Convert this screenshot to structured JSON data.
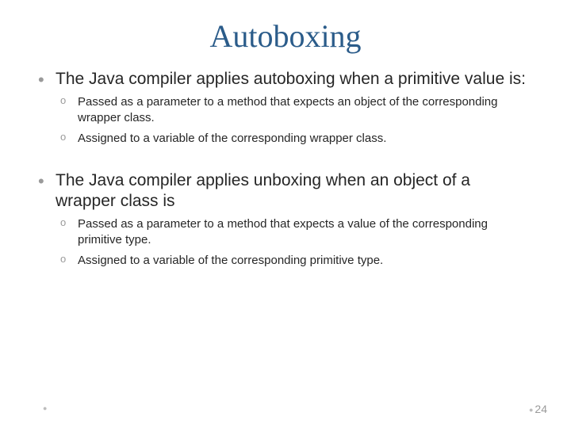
{
  "title": "Autoboxing",
  "bullets": {
    "item1": {
      "text": "The Java compiler applies autoboxing when a primitive value is:",
      "sub1": "Passed as a parameter to a method that expects an object of the corresponding wrapper class.",
      "sub2": "Assigned to a variable of the corresponding wrapper class."
    },
    "item2": {
      "text": "The Java compiler applies unboxing when an object of a wrapper class is",
      "sub1": "Passed as a parameter to a method that expects a value of the corresponding primitive type.",
      "sub2": "Assigned to a variable of the corresponding primitive type."
    }
  },
  "pageNumber": "24"
}
